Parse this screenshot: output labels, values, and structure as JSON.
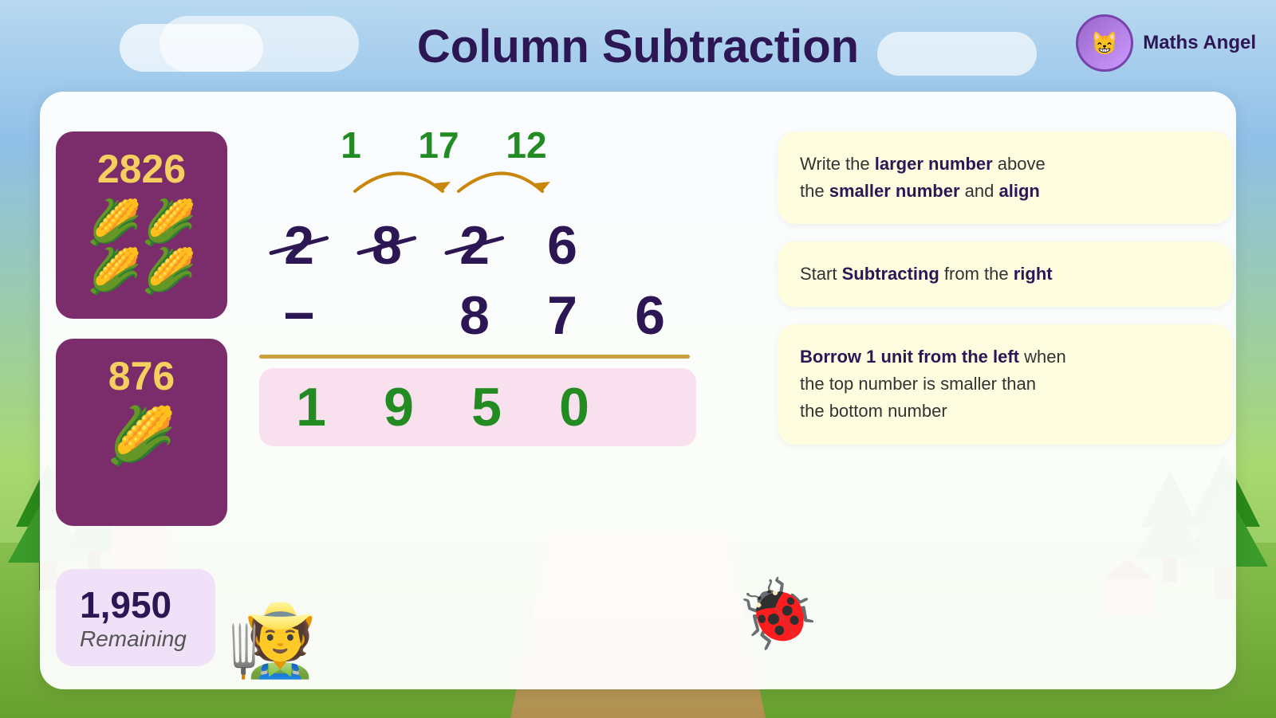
{
  "title": "Column Subtraction",
  "logo": {
    "text": "Maths Angel",
    "emoji": "🐱"
  },
  "cards": {
    "top": {
      "number": "2826",
      "emoji": "🌽🌽🌽"
    },
    "bottom": {
      "number": "876",
      "emoji": "🌽"
    }
  },
  "calculation": {
    "borrow": {
      "col1": "1",
      "col2": "17",
      "col3": "12",
      "col4": ""
    },
    "top_number": {
      "d1": "2",
      "d2": "8",
      "d3": "2",
      "d4": "6",
      "struck": [
        true,
        true,
        true,
        false
      ]
    },
    "bottom_number": {
      "d1": "",
      "d2": "8",
      "d3": "7",
      "d4": "6"
    },
    "result": {
      "d1": "1",
      "d2": "9",
      "d3": "5",
      "d4": "0"
    }
  },
  "info_boxes": [
    {
      "text_before": "Write the ",
      "bold1": "larger number",
      "text_middle": " above the ",
      "bold2": "smaller number",
      "text_end": " and ",
      "bold3": "align"
    },
    {
      "text_before": "Start ",
      "bold1": "Subtracting",
      "text_end": " from the ",
      "bold2": "right"
    },
    {
      "bold1": "Borrow 1 unit from the left",
      "text_end": " when the top number is smaller than the bottom number"
    }
  ],
  "result_banner": {
    "number": "1,950",
    "label": "Remaining"
  }
}
